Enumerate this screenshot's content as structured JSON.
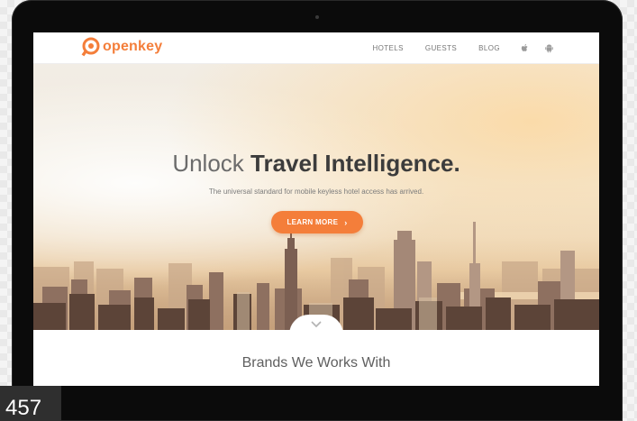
{
  "brand": {
    "name": "openkey",
    "color": "#f47e3a"
  },
  "nav": {
    "links": [
      "HOTELS",
      "GUESTS",
      "BLOG"
    ],
    "icons": [
      "apple-icon",
      "android-icon"
    ]
  },
  "hero": {
    "title_light": "Unlock",
    "title_bold": "Travel Intelligence.",
    "subtitle": "The universal standard for mobile keyless hotel access has arrived.",
    "cta_label": "LEARN MORE",
    "cta_icon": "chevron-right-icon"
  },
  "scroll": {
    "icon": "chevron-down-icon"
  },
  "brands": {
    "title": "Brands We Works With"
  },
  "overlay": {
    "counter": "457"
  }
}
